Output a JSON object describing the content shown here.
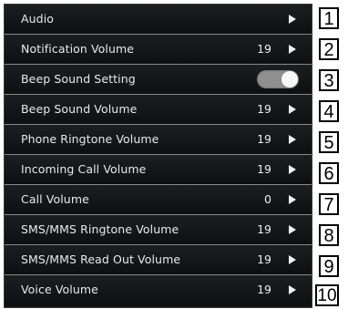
{
  "settings": {
    "rows": [
      {
        "label": "Audio",
        "value": "",
        "control": "arrow"
      },
      {
        "label": "Notification Volume",
        "value": "19",
        "control": "arrow"
      },
      {
        "label": "Beep Sound Setting",
        "value": "",
        "control": "toggle",
        "toggle_on": true
      },
      {
        "label": "Beep Sound Volume",
        "value": "19",
        "control": "arrow"
      },
      {
        "label": "Phone Ringtone Volume",
        "value": "19",
        "control": "arrow"
      },
      {
        "label": "Incoming Call Volume",
        "value": "19",
        "control": "arrow"
      },
      {
        "label": "Call Volume",
        "value": "0",
        "control": "arrow"
      },
      {
        "label": "SMS/MMS Ringtone Volume",
        "value": "19",
        "control": "arrow"
      },
      {
        "label": "SMS/MMS Read Out Volume",
        "value": "19",
        "control": "arrow"
      },
      {
        "label": "Voice Volume",
        "value": "19",
        "control": "arrow"
      }
    ]
  },
  "callouts": [
    "1",
    "2",
    "3",
    "4",
    "5",
    "6",
    "7",
    "8",
    "9",
    "10"
  ],
  "colors": {
    "screen_bg": "#101114",
    "text": "#e9e9e9",
    "divider": "#8a8a8a",
    "toggle_track": "#8f8f8f",
    "toggle_knob": "#f6f6f6"
  }
}
